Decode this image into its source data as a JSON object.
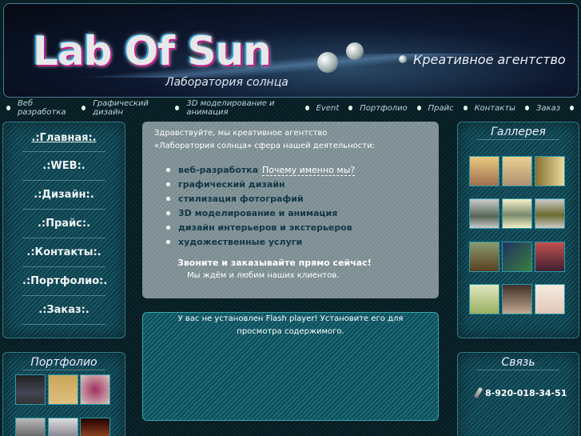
{
  "header": {
    "logo": "Lab Of Sun",
    "subtitle": "Лаборатория солнца",
    "tagline": "Креативное агентство"
  },
  "nav": [
    "Веб разработка",
    "Графический дизайн",
    "3D моделирование и анимация",
    "Event",
    "Портфолио",
    "Прайс",
    "Контакты",
    "Заказ"
  ],
  "menu": [
    ".:Главная:.",
    ".:WEB:.",
    ".:Дизайн:.",
    ".:Прайс:.",
    ".:Контакты:.",
    ".:Портфолио:.",
    ".:Заказ:."
  ],
  "portfolio": {
    "title": "Портфолио"
  },
  "gallery": {
    "title": "Галлерея"
  },
  "contact": {
    "title": "Связь",
    "phone": "8-920-018-34-51",
    "icon": "phone-icon"
  },
  "main": {
    "intro1": "Здравствуйте, мы креативное агентство",
    "intro2": "«Лаборатория солнца» сфера нашей деятельности:",
    "services": [
      "веб-разработка",
      "графический дизайн",
      "стилизация фотографий",
      "3D моделирование и анимация",
      "дизайн интерьеров и экстерьеров",
      "художественные услуги"
    ],
    "why_link": "Почему именно мы?",
    "call": "Звоните и заказывайте прямо сейчас!",
    "love": "Мы ждём и любим наших клиентов."
  },
  "flash": {
    "message": "У вас не установлен Flash player! Установите его для просмотра содержимого."
  }
}
